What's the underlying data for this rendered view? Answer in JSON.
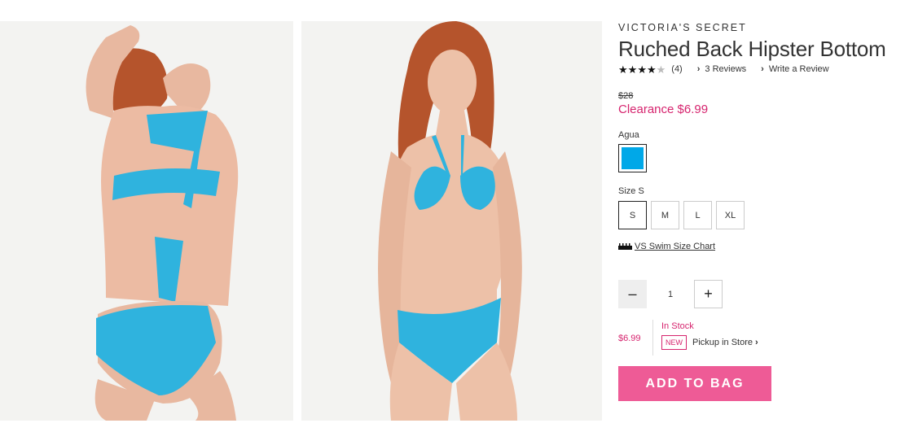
{
  "product": {
    "brand": "VICTORIA'S SECRET",
    "title": "Ruched Back Hipster Bottom",
    "rating": 4,
    "rating_max": 5,
    "review_count": "(4)",
    "reviews_link": "3 Reviews",
    "write_review_link": "Write a Review"
  },
  "pricing": {
    "original": "$28",
    "sale": "Clearance $6.99"
  },
  "color": {
    "label": "Agua",
    "swatch_hex": "#00a8e8"
  },
  "size": {
    "label": "Size S",
    "options": [
      "S",
      "M",
      "L",
      "XL"
    ],
    "selected": "S"
  },
  "size_chart": {
    "label": "VS Swim Size Chart",
    "icon": "ruler-icon"
  },
  "quantity": {
    "minus": "–",
    "value": "1",
    "plus": "+"
  },
  "availability": {
    "price": "$6.99",
    "status": "In Stock",
    "badge": "NEW",
    "pickup": "Pickup in Store"
  },
  "cta": {
    "add_to_bag": "ADD TO BAG"
  },
  "images": [
    {
      "name": "product-photo-back",
      "accent": "#2fb3de"
    },
    {
      "name": "product-photo-front",
      "accent": "#2fb3de"
    }
  ],
  "colors": {
    "sale_pink": "#d6246e",
    "button_pink": "#ee5b96"
  }
}
